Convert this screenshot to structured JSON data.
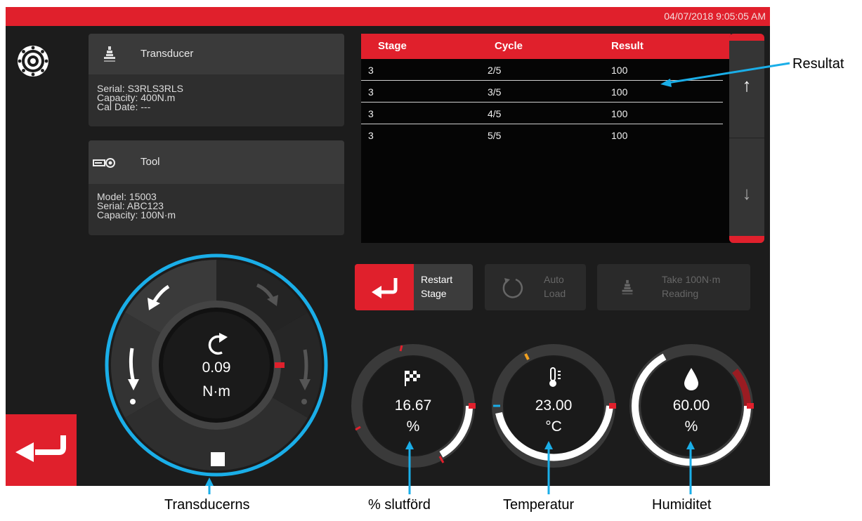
{
  "header": {
    "datetime": "04/07/2018 9:05:05 AM"
  },
  "transducer_card": {
    "title": "Transducer",
    "lines": [
      "Serial: S3RLS3RLS",
      "Capacity: 400N.m",
      "Cal Date: ---"
    ]
  },
  "tool_card": {
    "title": "Tool",
    "lines": [
      "Model: 15003",
      "Serial: ABC123",
      "Capacity: 100N·m"
    ]
  },
  "results_table": {
    "columns": [
      "Stage",
      "Cycle",
      "Result"
    ],
    "rows": [
      [
        "3",
        "2/5",
        "100"
      ],
      [
        "3",
        "3/5",
        "100"
      ],
      [
        "3",
        "4/5",
        "100"
      ],
      [
        "3",
        "5/5",
        "100"
      ]
    ]
  },
  "buttons": {
    "restart_line1": "Restart",
    "restart_line2": "Stage",
    "auto_line1": "Auto",
    "auto_line2": "Load",
    "take_line1": "Take 100N·m",
    "take_line2": "Reading"
  },
  "dial": {
    "value": "0.09",
    "unit": "N·m"
  },
  "gauges": {
    "progress": {
      "value": "16.67",
      "unit": "%",
      "fraction": 0.1667
    },
    "temperature": {
      "value": "23.00",
      "unit": "°C"
    },
    "humidity": {
      "value": "60.00",
      "unit": "%"
    }
  },
  "annotations": {
    "results": "Resultat",
    "transducer": "Transducerns",
    "progress": "% slutförd",
    "temperature": "Temperatur",
    "humidity": "Humiditet"
  },
  "colors": {
    "accent_red": "#e0202c",
    "annotation_blue": "#1aaee8",
    "panel_dark": "#1c1c1c",
    "warning_orange": "#f0a020"
  },
  "icons": [
    "gear-icon",
    "transducer-icon",
    "tool-icon",
    "restart-icon",
    "auto-load-icon",
    "take-reading-icon",
    "back-arrow-icon",
    "checkered-flag-icon",
    "thermometer-icon",
    "water-drop-icon",
    "rotate-icon",
    "stop-icon",
    "scroll-up-icon",
    "scroll-down-icon"
  ]
}
